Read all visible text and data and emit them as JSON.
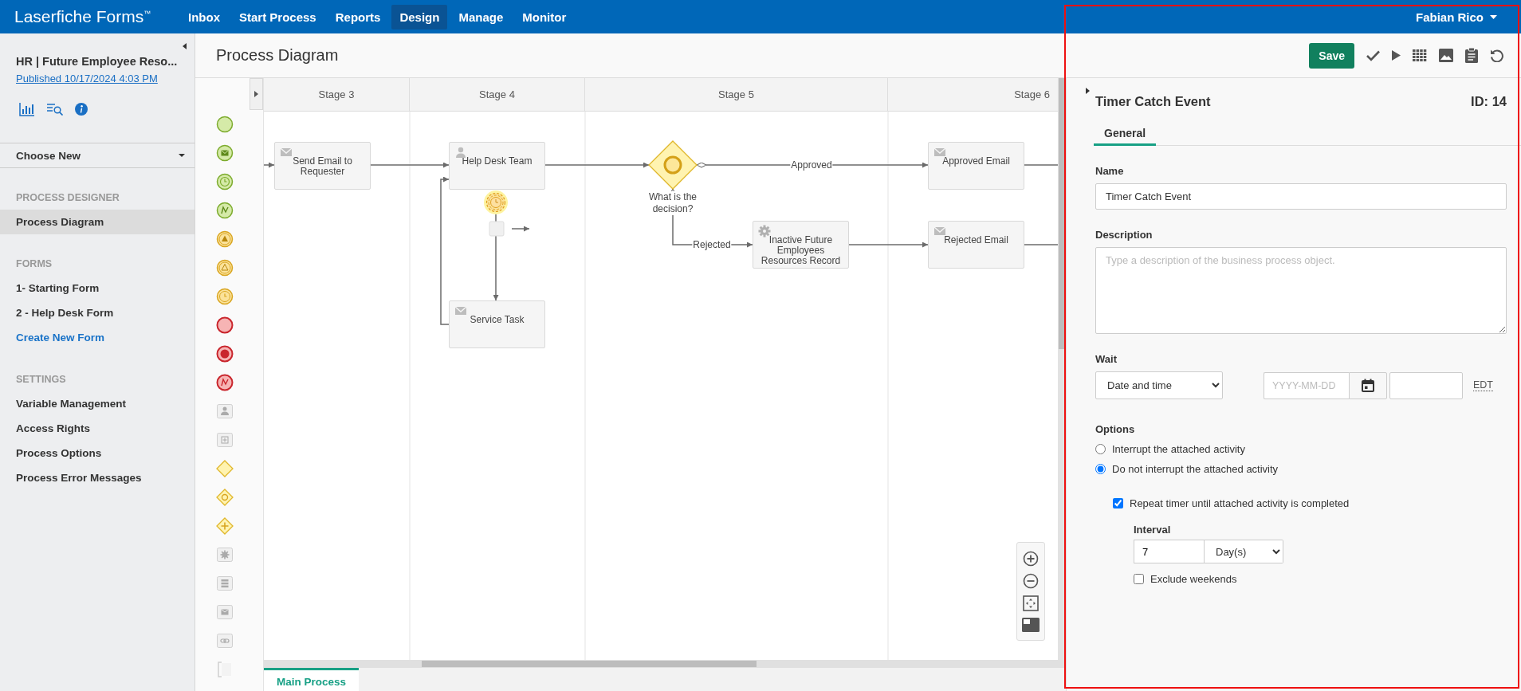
{
  "app": {
    "title": "Laserfiche Forms$^{™}$"
  },
  "nav": [
    {
      "label": "Inbox",
      "selected": false
    },
    {
      "label": "Start Process",
      "selected": false
    },
    {
      "label": "Reports",
      "selected": false
    },
    {
      "label": "Design",
      "selected": true
    },
    {
      "label": "Manage",
      "selected": false
    },
    {
      "label": "Monitor",
      "selected": false
    }
  ],
  "user": {
    "name": "Fabian Rico"
  },
  "sidebar": {
    "process_title": "HR | Future Employee Reso...",
    "published_link": "Published 10/17/2024 4:03 PM",
    "choose_new": "Choose New",
    "sections": [
      {
        "heading": "PROCESS DESIGNER",
        "items": [
          {
            "label": "Process Diagram",
            "selected": true,
            "kind": "page"
          }
        ]
      },
      {
        "heading": "FORMS",
        "items": [
          {
            "label": "1- Starting Form",
            "selected": false,
            "kind": "page"
          },
          {
            "label": "2 - Help Desk Form",
            "selected": false,
            "kind": "page"
          },
          {
            "label": "Create New Form",
            "selected": false,
            "kind": "action"
          }
        ]
      },
      {
        "heading": "SETTINGS",
        "items": [
          {
            "label": "Variable Management",
            "selected": false,
            "kind": "page"
          },
          {
            "label": "Access Rights",
            "selected": false,
            "kind": "page"
          },
          {
            "label": "Process Options",
            "selected": false,
            "kind": "page"
          },
          {
            "label": "Process Error Messages",
            "selected": false,
            "kind": "page"
          }
        ]
      }
    ]
  },
  "page": {
    "title": "Process Diagram"
  },
  "toolbar": {
    "save": "Save"
  },
  "diagram": {
    "stages": [
      "Stage 3",
      "Stage 4",
      "Stage 5",
      "Stage 6"
    ],
    "nodes": [
      {
        "kind": "email",
        "label": "Send Email to Requester"
      },
      {
        "kind": "user",
        "label": "Help Desk Team"
      },
      {
        "kind": "email",
        "label": "Service Task"
      },
      {
        "kind": "gateway",
        "label": "What is the decision?"
      },
      {
        "kind": "service",
        "label": "Inactive Future Employees Resources Record"
      },
      {
        "kind": "email",
        "label": "Approved Email"
      },
      {
        "kind": "email",
        "label": "Rejected Email"
      }
    ],
    "flow_labels": [
      "Approved",
      "Rejected"
    ],
    "timer": {
      "selected": true
    },
    "tabs": [
      {
        "label": "Main Process",
        "selected": true
      }
    ]
  },
  "properties": {
    "title": "Timer Catch Event",
    "id": "ID: 14",
    "tabs": [
      {
        "label": "General",
        "selected": true
      }
    ],
    "name": {
      "label": "Name",
      "value": "Timer Catch Event"
    },
    "description": {
      "label": "Description",
      "placeholder": "Type a description of the business process object."
    },
    "wait": {
      "label": "Wait",
      "type": "Date and time",
      "date_placeholder": "YYYY-MM-DD",
      "timezone": "EDT"
    },
    "options": {
      "label": "Options",
      "radios": [
        {
          "label": "Interrupt the attached activity",
          "selected": false
        },
        {
          "label": "Do not interrupt the attached activity",
          "selected": true
        }
      ],
      "repeat": {
        "label": "Repeat timer until attached activity is completed",
        "checked": true
      },
      "interval": {
        "label": "Interval",
        "value": "7",
        "unit": "Day(s)"
      },
      "exclude_weekends": {
        "label": "Exclude weekends",
        "checked": false
      }
    }
  }
}
